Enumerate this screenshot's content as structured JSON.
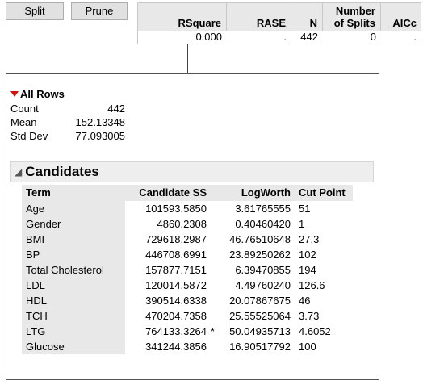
{
  "toolbar": {
    "split_label": "Split",
    "prune_label": "Prune"
  },
  "summary": {
    "headers": {
      "rsquare": "RSquare",
      "rase": "RASE",
      "n": "N",
      "splits_line1": "Number",
      "splits_line2": "of Splits",
      "aicc": "AICc"
    },
    "values": {
      "rsquare": "0.000",
      "rase": ".",
      "n": "442",
      "splits": "0",
      "aicc": "."
    }
  },
  "node": {
    "title": "All Rows",
    "stats": [
      {
        "label": "Count",
        "value": "442"
      },
      {
        "label": "Mean",
        "value": "152.13348"
      },
      {
        "label": "Std Dev",
        "value": "77.093005"
      }
    ]
  },
  "candidates": {
    "title": "Candidates",
    "columns": {
      "term": "Term",
      "ss": "Candidate SS",
      "logworth": "LogWorth",
      "cut": "Cut Point"
    },
    "rows": [
      {
        "term": "Age",
        "ss": "101593.5850",
        "star": "",
        "logworth": "3.61765555",
        "cut": "51"
      },
      {
        "term": "Gender",
        "ss": "4860.2308",
        "star": "",
        "logworth": "0.40460420",
        "cut": "1"
      },
      {
        "term": "BMI",
        "ss": "729618.2987",
        "star": "",
        "logworth": "46.76510648",
        "cut": "27.3"
      },
      {
        "term": "BP",
        "ss": "446708.6991",
        "star": "",
        "logworth": "23.89250262",
        "cut": "102"
      },
      {
        "term": "Total Cholesterol",
        "ss": "157877.7151",
        "star": "",
        "logworth": "6.39470855",
        "cut": "194"
      },
      {
        "term": "LDL",
        "ss": "120014.5872",
        "star": "",
        "logworth": "4.49760240",
        "cut": "126.6"
      },
      {
        "term": "HDL",
        "ss": "390514.6338",
        "star": "",
        "logworth": "20.07867675",
        "cut": "46"
      },
      {
        "term": "TCH",
        "ss": "470204.7358",
        "star": "",
        "logworth": "25.55525064",
        "cut": "3.73"
      },
      {
        "term": "LTG",
        "ss": "764133.3264",
        "star": "*",
        "logworth": "50.04935713",
        "cut": "4.6052"
      },
      {
        "term": "Glucose",
        "ss": "341244.3856",
        "star": "",
        "logworth": "16.90517792",
        "cut": "100"
      }
    ]
  },
  "colors": {
    "menu_triangle": "#d01010",
    "header_bg": "#e8e8e8"
  }
}
